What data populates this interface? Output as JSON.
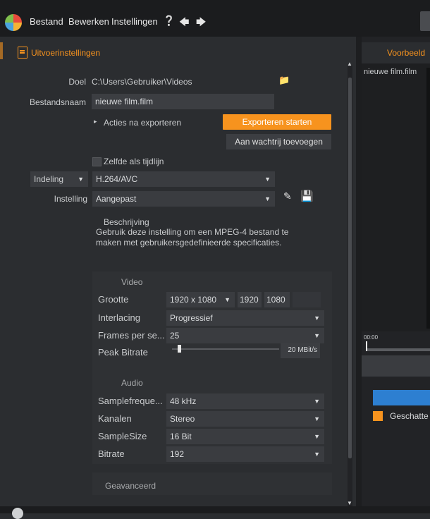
{
  "menubar": {
    "items": [
      "Bestand",
      "Bewerken",
      "Instellingen"
    ],
    "icons": [
      "help-icon",
      "undo-icon",
      "redo-icon"
    ]
  },
  "panel": {
    "title": "Uitvoerinstellingen"
  },
  "form": {
    "doel_label": "Doel",
    "doel_value": "C:\\Users\\Gebruiker\\Videos",
    "bestandsnaam_label": "Bestandsnaam",
    "bestandsnaam_value": "nieuwe film.film",
    "acties_label": "Acties na exporteren",
    "export_button": "Exporteren starten",
    "queue_button": "Aan wachtrij toevoegen",
    "zelfde_label": "Zelfde als tijdlijn",
    "indeling_label": "Indeling",
    "indeling_value": "H.264/AVC",
    "instelling_label": "Instelling",
    "instelling_value": "Aangepast",
    "beschrijving_title": "Beschrijving",
    "beschrijving_text": "Gebruik deze instelling om een MPEG-4 bestand te maken met gebruikersgedefinieerde specificaties."
  },
  "video": {
    "title": "Video",
    "grootte_label": "Grootte",
    "grootte_value": "1920 x 1080",
    "width": "1920",
    "height": "1080",
    "interlacing_label": "Interlacing",
    "interlacing_value": "Progressief",
    "fps_label": "Frames per se...",
    "fps_value": "25",
    "bitrate_label": "Peak Bitrate",
    "bitrate_value": "20 MBit/s",
    "bitrate_level": 0.05
  },
  "audio": {
    "title": "Audio",
    "samplefreq_label": "Samplefreque...",
    "samplefreq_value": "48 kHz",
    "kanalen_label": "Kanalen",
    "kanalen_value": "Stereo",
    "samplesize_label": "SampleSize",
    "samplesize_value": "16 Bit",
    "bitrate_label": "Bitrate",
    "bitrate_value": "192"
  },
  "advanced": {
    "title": "Geavanceerd"
  },
  "preview": {
    "tab_label": "Voorbeeld",
    "file_name": "nieuwe film.film",
    "timecode": "00:00",
    "legend_label": "Geschatte"
  },
  "colors": {
    "accent": "#f7931e",
    "progress": "#2d7fd1",
    "background": "#2b2d30"
  }
}
